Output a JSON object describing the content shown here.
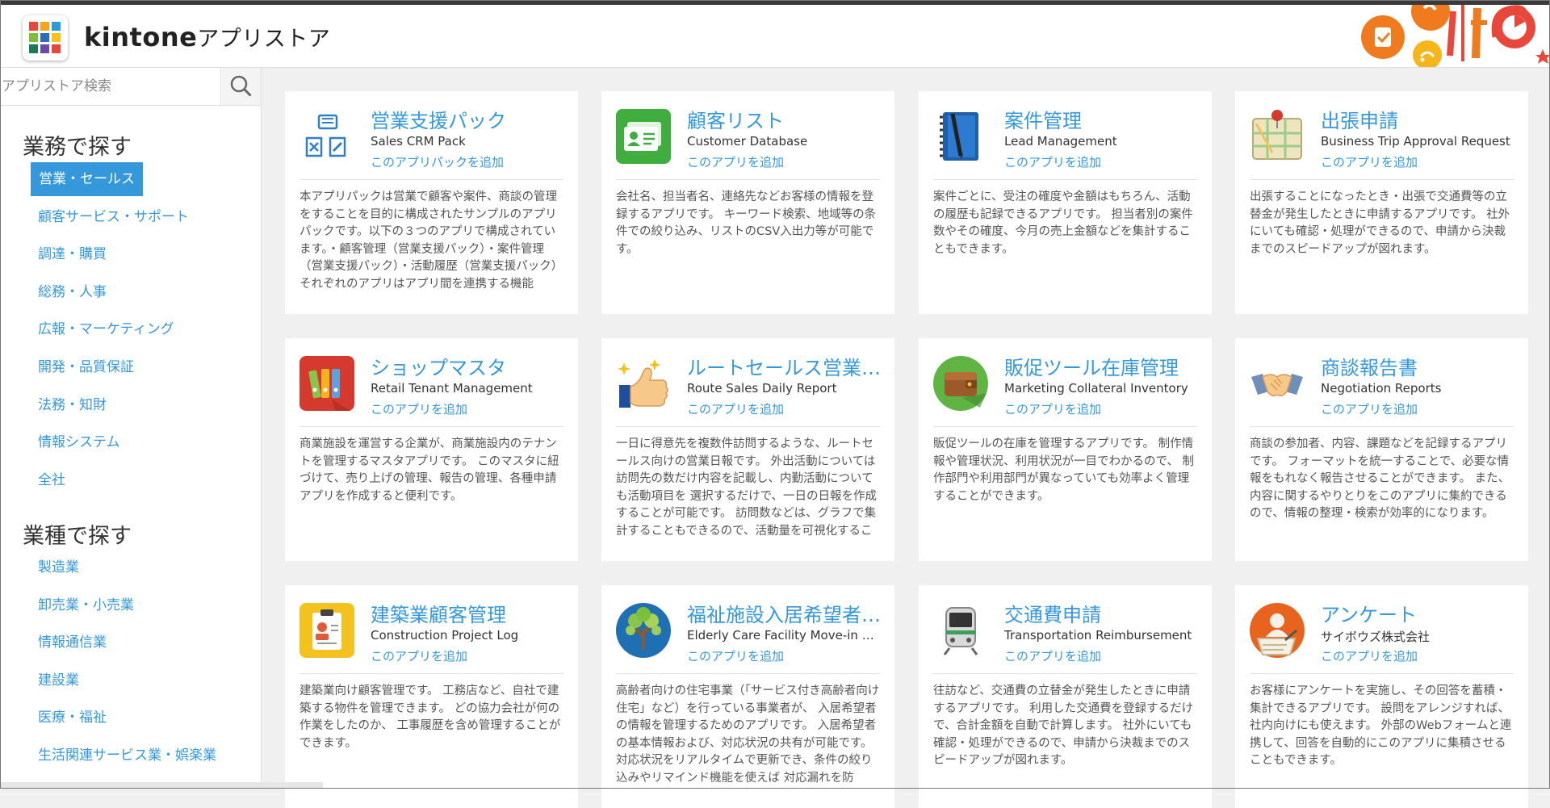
{
  "header": {
    "brand": "kintone",
    "title_suffix": "アプリストア"
  },
  "colors": {
    "accent": "#3498db",
    "text": "#333333",
    "card_bg": "#ffffff",
    "page_bg": "#f0f0f0"
  },
  "sidebar": {
    "search": {
      "placeholder": "アプリストア検索",
      "value": ""
    },
    "section1": {
      "title": "業務で探す",
      "items": [
        {
          "label": "営業・セールス",
          "active": true
        },
        {
          "label": "顧客サービス・サポート"
        },
        {
          "label": "調達・購買"
        },
        {
          "label": "総務・人事"
        },
        {
          "label": "広報・マーケティング"
        },
        {
          "label": "開発・品質保証"
        },
        {
          "label": "法務・知財"
        },
        {
          "label": "情報システム"
        },
        {
          "label": "全社"
        }
      ]
    },
    "section2": {
      "title": "業種で探す",
      "items": [
        {
          "label": "製造業"
        },
        {
          "label": "卸売業・小売業"
        },
        {
          "label": "情報通信業"
        },
        {
          "label": "建設業"
        },
        {
          "label": "医療・福祉"
        },
        {
          "label": "生活関連サービス業・娯楽業"
        }
      ]
    }
  },
  "cards": [
    {
      "title": "営業支援パック",
      "subtitle": "Sales CRM Pack",
      "add": "このアプリパックを追加",
      "icon": "document-pack-icon",
      "desc": "本アプリパックは営業で顧客や案件、商談の管理をすることを目的に構成されたサンプルのアプリパックです。以下の３つのアプリで構成されています。・顧客管理（営業支援パック）・案件管理（営業支援パック）・活動履歴（営業支援パック）それぞれのアプリはアプリ間を連携する機能"
    },
    {
      "title": "顧客リスト",
      "subtitle": "Customer Database",
      "add": "このアプリを追加",
      "icon": "contact-cards-icon",
      "desc": "会社名、担当者名、連絡先などお客様の情報を登録するアプリです。 キーワード検索、地域等の条件での絞り込み、リストのCSV入出力等が可能です。"
    },
    {
      "title": "案件管理",
      "subtitle": "Lead Management",
      "add": "このアプリを追加",
      "icon": "notebook-pen-icon",
      "desc": "案件ごとに、受注の確度や金額はもちろん、活動の履歴も記録できるアプリです。 担当者別の案件数やその確度、今月の売上金額などを集計することもできます。"
    },
    {
      "title": "出張申請",
      "subtitle": "Business Trip Approval Request",
      "add": "このアプリを追加",
      "icon": "map-pin-icon",
      "desc": "出張することになったとき・出張で交通費等の立替金が発生したときに申請するアプリです。 社外にいても確認・処理ができるので、申請から決裁までのスピードアップが図れます。"
    },
    {
      "title": "ショップマスタ",
      "subtitle": "Retail Tenant Management",
      "add": "このアプリを追加",
      "icon": "binders-icon",
      "desc": "商業施設を運営する企業が、商業施設内のテナントを管理するマスタアプリです。 このマスタに紐づけて、売り上げの管理、報告の管理、各種申請アプリを作成すると便利です。"
    },
    {
      "title": "ルートセールス営業…",
      "subtitle": "Route Sales Daily Report",
      "add": "このアプリを追加",
      "icon": "thumbs-up-icon",
      "desc": "一日に得意先を複数件訪問するような、ルートセールス向けの営業日報です。 外出活動については訪問先の数だけ内容を記載し、内勤活動についても活動項目を 選択するだけで、一日の日報を作成することが可能です。 訪問数などは、グラフで集計することもできるので、活動量を可視化するこ"
    },
    {
      "title": "販促ツール在庫管理",
      "subtitle": "Marketing Collateral Inventory",
      "add": "このアプリを追加",
      "icon": "wallet-icon",
      "desc": "販促ツールの在庫を管理するアプリです。 制作情報や管理状況、利用状況が一目でわかるので、 制作部門や利用部門が異なっていても効率よく管理することができます。"
    },
    {
      "title": "商談報告書",
      "subtitle": "Negotiation Reports",
      "add": "このアプリを追加",
      "icon": "handshake-icon",
      "desc": "商談の参加者、内容、課題などを記録するアプリです。 フォーマットを統一することで、必要な情報をもれなく報告させることができます。 また、内容に関するやりとりをこのアプリに集約できるので、情報の整理・検索が効率的になります。"
    },
    {
      "title": "建築業顧客管理",
      "subtitle": "Construction Project Log",
      "add": "このアプリを追加",
      "icon": "clipboard-worker-icon",
      "desc": "建築業向け顧客管理です。 工務店など、自社で建築する物件を管理できます。 どの協力会社が何の作業をしたのか、 工事履歴を含め管理することができます。"
    },
    {
      "title": "福祉施設入居希望者…",
      "subtitle": "Elderly Care Facility Move-in Ca…",
      "add": "このアプリを追加",
      "icon": "tree-icon",
      "desc": "高齢者向けの住宅事業（「サービス付き高齢者向け住宅」など）を行っている事業者が、 入居希望者の情報を管理するためのアプリです。 入居希望者の基本情報および、対応状況の共有が可能です。 対応状況をリアルタイムで更新でき、条件の絞り込みやリマインド機能を使えば 対応漏れを防"
    },
    {
      "title": "交通費申請",
      "subtitle": "Transportation Reimbursement",
      "add": "このアプリを追加",
      "icon": "train-icon",
      "desc": "往訪など、交通費の立替金が発生したときに申請するアプリです。 利用した交通費を登録するだけで、合計金額を自動で計算します。 社外にいても確認・処理ができるので、申請から決裁までのスピードアップが図れます。"
    },
    {
      "title": "アンケート",
      "subtitle": "サイボウズ株式会社",
      "add": "このアプリを追加",
      "icon": "survey-icon",
      "desc": "お客様にアンケートを実施し、その回答を蓄積・集計できるアプリです。 設問をアレンジすれば、社内向けにも使えます。 外部のWebフォームと連携して、回答を自動的にこのアプリに集積させることもできます。"
    }
  ]
}
